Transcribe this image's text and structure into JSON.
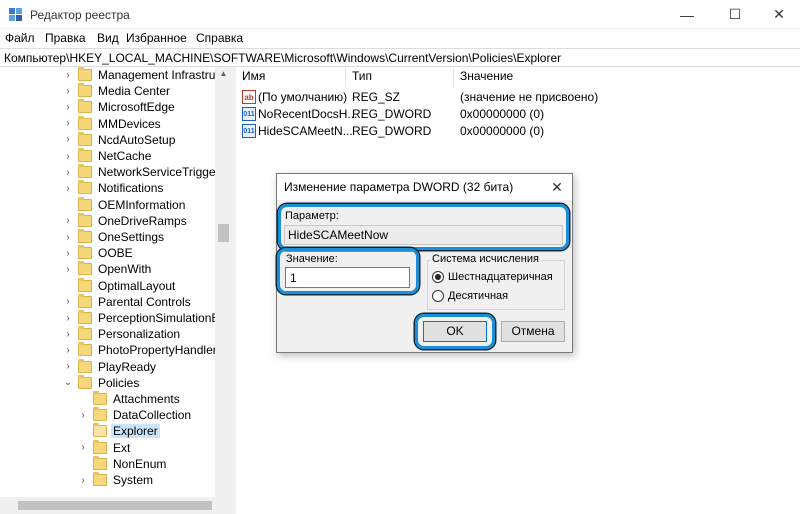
{
  "window": {
    "title": "Редактор реестра",
    "minimize": "—",
    "maximize": "☐",
    "close": "✕"
  },
  "menu": [
    "Файл",
    "Правка",
    "Вид",
    "Избранное",
    "Справка"
  ],
  "address": "Компьютер\\HKEY_LOCAL_MACHINE\\SOFTWARE\\Microsoft\\Windows\\CurrentVersion\\Policies\\Explorer",
  "tree": {
    "items": [
      {
        "label": "Management Infrastructu",
        "expander": "›"
      },
      {
        "label": "Media Center",
        "expander": "›"
      },
      {
        "label": "MicrosoftEdge",
        "expander": "›"
      },
      {
        "label": "MMDevices",
        "expander": "›"
      },
      {
        "label": "NcdAutoSetup",
        "expander": "›"
      },
      {
        "label": "NetCache",
        "expander": "›"
      },
      {
        "label": "NetworkServiceTriggers",
        "expander": "›"
      },
      {
        "label": "Notifications",
        "expander": "›"
      },
      {
        "label": "OEMInformation",
        "expander": ""
      },
      {
        "label": "OneDriveRamps",
        "expander": "›"
      },
      {
        "label": "OneSettings",
        "expander": "›"
      },
      {
        "label": "OOBE",
        "expander": "›"
      },
      {
        "label": "OpenWith",
        "expander": "›"
      },
      {
        "label": "OptimalLayout",
        "expander": ""
      },
      {
        "label": "Parental Controls",
        "expander": "›"
      },
      {
        "label": "PerceptionSimulationExt",
        "expander": "›"
      },
      {
        "label": "Personalization",
        "expander": "›"
      },
      {
        "label": "PhotoPropertyHandler",
        "expander": "›"
      },
      {
        "label": "PlayReady",
        "expander": "›"
      },
      {
        "label": "Policies",
        "expander": "⌄"
      },
      {
        "label": "Attachments",
        "expander": ""
      },
      {
        "label": "DataCollection",
        "expander": "›"
      },
      {
        "label": "Explorer",
        "expander": "",
        "selected": true
      },
      {
        "label": "Ext",
        "expander": "›"
      },
      {
        "label": "NonEnum",
        "expander": ""
      },
      {
        "label": "System",
        "expander": "›"
      }
    ]
  },
  "list": {
    "columns": [
      "Имя",
      "Тип",
      "Значение"
    ],
    "rows": [
      {
        "icon": "ab",
        "name": "(По умолчанию)",
        "type": "REG_SZ",
        "value": "(значение не присвоено)"
      },
      {
        "icon": "011",
        "name": "NoRecentDocsH...",
        "type": "REG_DWORD",
        "value": "0x00000000 (0)"
      },
      {
        "icon": "011",
        "name": "HideSCAMeetN...",
        "type": "REG_DWORD",
        "value": "0x00000000 (0)"
      }
    ]
  },
  "dialog": {
    "title": "Изменение параметра DWORD (32 бита)",
    "close": "✕",
    "param_label": "Параметр:",
    "param_value": "HideSCAMeetNow",
    "value_label": "Значение:",
    "value_input": "1",
    "base_label": "Система исчисления",
    "radio_hex": "Шестнадцатеричная",
    "radio_dec": "Десятичная",
    "ok": "OK",
    "cancel": "Отмена"
  },
  "colors": {
    "highlight": "#1a8fd6",
    "selection": "#cce4f7",
    "folder": "#f6d87a"
  }
}
